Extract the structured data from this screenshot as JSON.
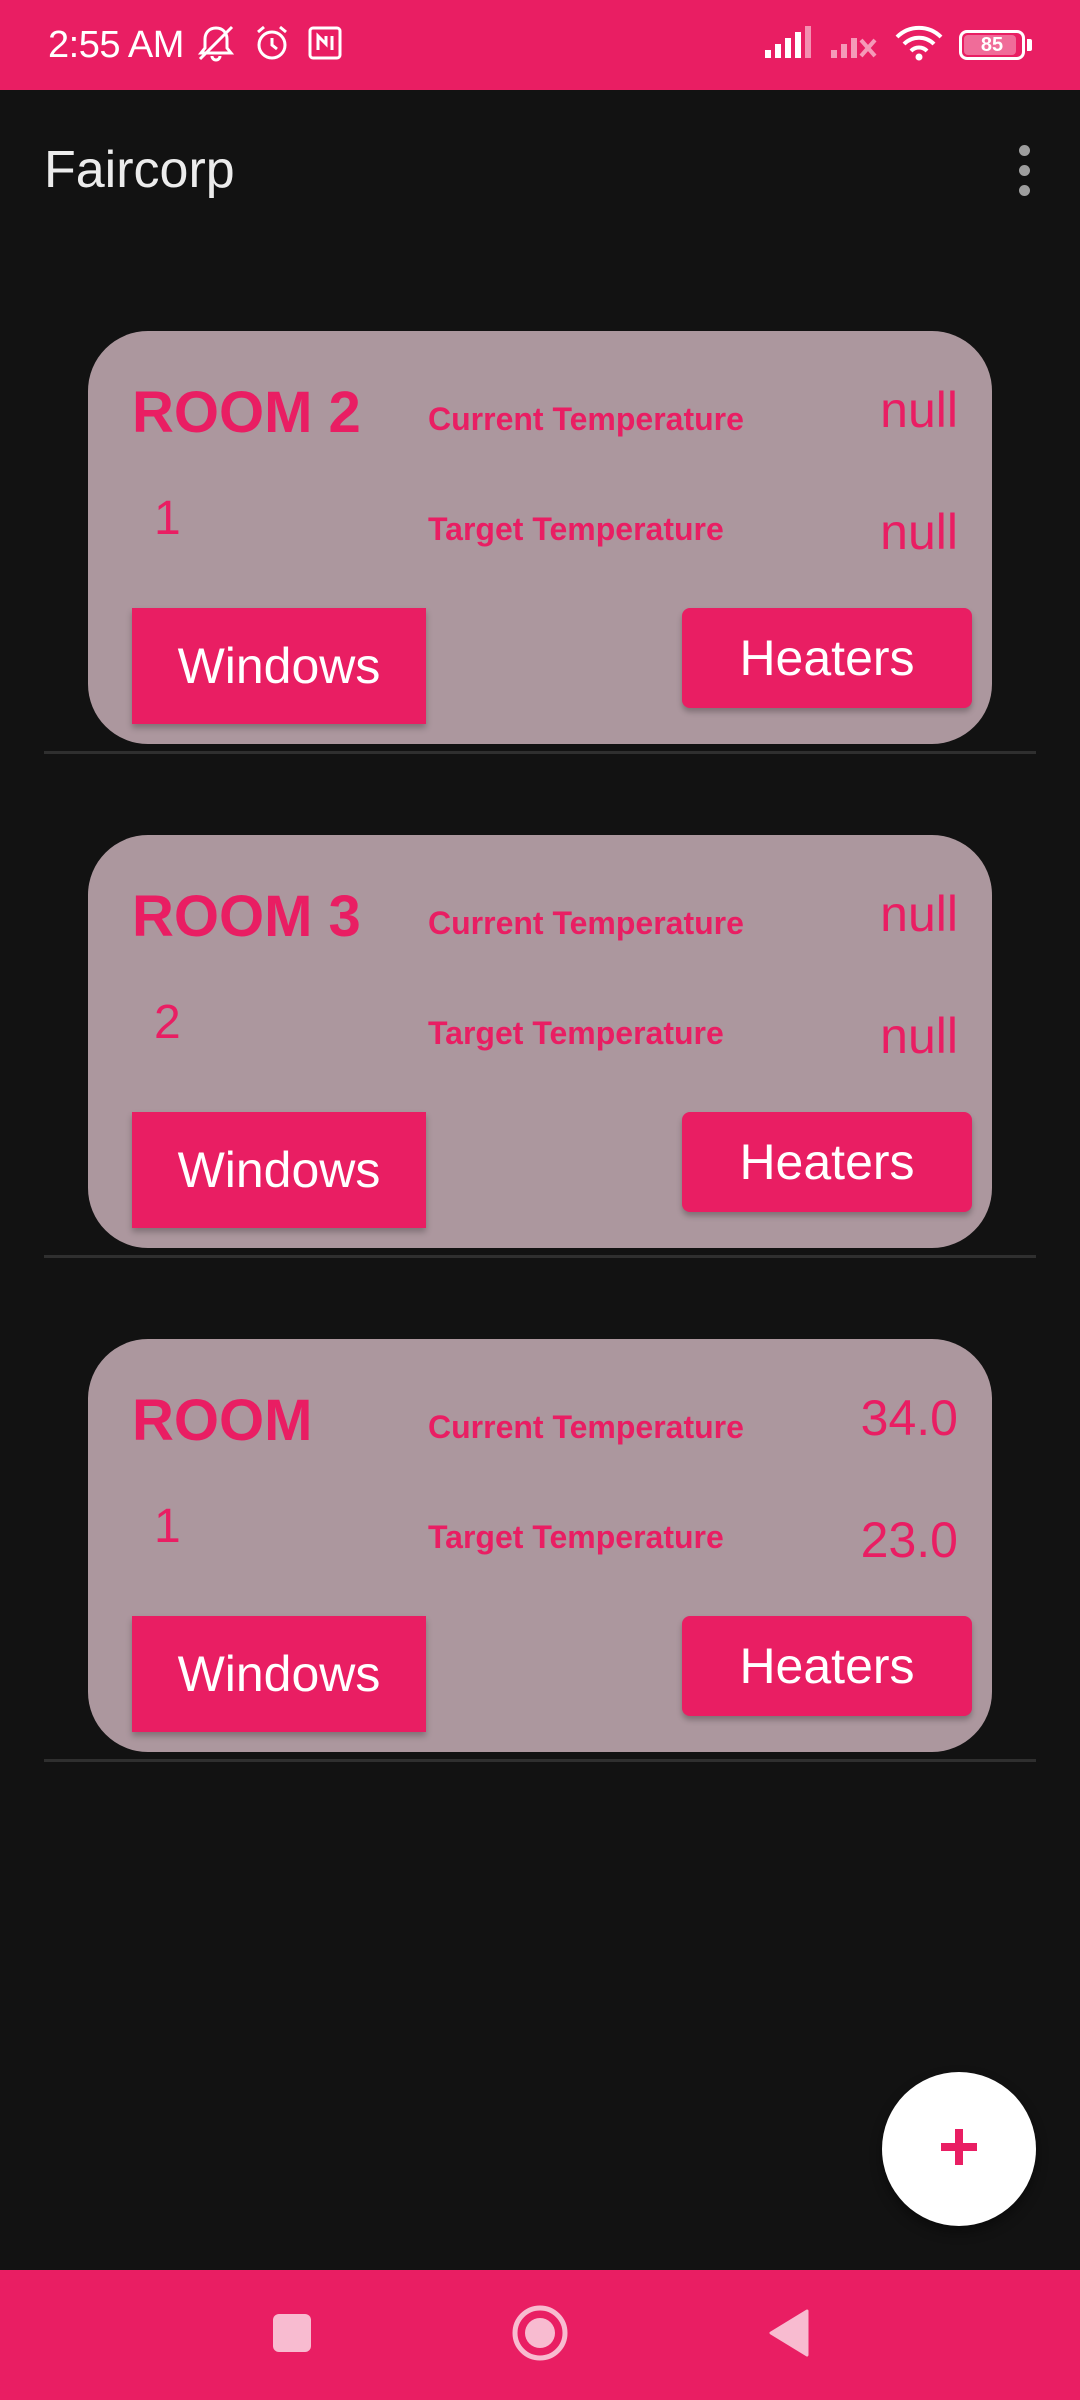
{
  "status_bar": {
    "time": "2:55 AM",
    "icons": [
      "mute-bell-icon",
      "alarm-icon",
      "nfc-icon",
      "signal-icon",
      "signal-no-service-icon",
      "wifi-icon",
      "battery-icon"
    ],
    "battery_level": "85"
  },
  "app_bar": {
    "title": "Faircorp",
    "menu_icon": "overflow-menu-icon"
  },
  "rooms": [
    {
      "name": "ROOM 2",
      "id": "1",
      "current_temperature_label": "Current Temperature",
      "current_temperature": "null",
      "target_temperature_label": "Target Temperature",
      "target_temperature": "null",
      "windows_label": "Windows",
      "heaters_label": "Heaters"
    },
    {
      "name": "ROOM 3",
      "id": "2",
      "current_temperature_label": "Current Temperature",
      "current_temperature": "null",
      "target_temperature_label": "Target Temperature",
      "target_temperature": "null",
      "windows_label": "Windows",
      "heaters_label": "Heaters"
    },
    {
      "name": "ROOM",
      "id": "1",
      "current_temperature_label": "Current Temperature",
      "current_temperature": "34.0",
      "target_temperature_label": "Target Temperature",
      "target_temperature": "23.0",
      "windows_label": "Windows",
      "heaters_label": "Heaters"
    }
  ],
  "fab": {
    "icon": "plus-icon"
  },
  "nav_bar": {
    "icons": [
      "recents-square-icon",
      "home-circle-icon",
      "back-triangle-icon"
    ]
  },
  "colors": {
    "accent": "#E91E63",
    "background": "#121212",
    "card": "#AC979E",
    "divider": "#2F2F2F"
  }
}
